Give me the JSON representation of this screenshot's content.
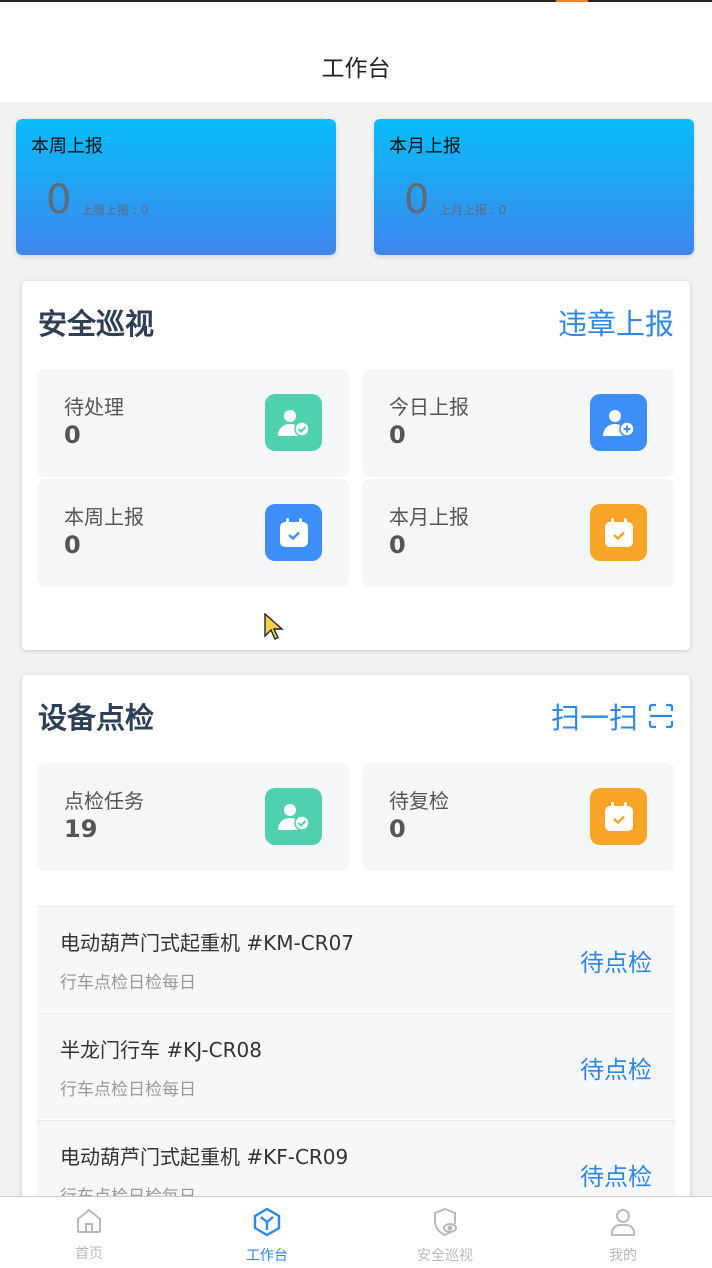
{
  "header": {
    "title": "工作台"
  },
  "summary": [
    {
      "label": "本周上报",
      "count": "0",
      "prev": "上周上报 : 0"
    },
    {
      "label": "本月上报",
      "count": "0",
      "prev": "上月上报 : 0"
    }
  ],
  "safety": {
    "title": "安全巡视",
    "action": "违章上报",
    "stats": [
      {
        "label": "待处理",
        "value": "0",
        "icon": "user-check-icon",
        "color": "#4fd1b0"
      },
      {
        "label": "今日上报",
        "value": "0",
        "icon": "user-add-icon",
        "color": "#3d8ef7"
      },
      {
        "label": "本周上报",
        "value": "0",
        "icon": "calendar-check-icon",
        "color": "#3d8ef7"
      },
      {
        "label": "本月上报",
        "value": "0",
        "icon": "calendar-check-icon",
        "color": "#f7a427"
      }
    ]
  },
  "inspection": {
    "title": "设备点检",
    "action": "扫一扫",
    "action_icon": "scan-icon",
    "stats": [
      {
        "label": "点检任务",
        "value": "19",
        "icon": "user-check-icon",
        "color": "#4fd1b0"
      },
      {
        "label": "待复检",
        "value": "0",
        "icon": "calendar-check-icon",
        "color": "#f7a427"
      }
    ],
    "items": [
      {
        "name": "电动葫芦门式起重机 #KM-CR07",
        "sub": "行车点检日检每日",
        "status": "待点检"
      },
      {
        "name": "半龙门行车 #KJ-CR08",
        "sub": "行车点检日检每日",
        "status": "待点检"
      },
      {
        "name": "电动葫芦门式起重机 #KF-CR09",
        "sub": "行车点检日检每日",
        "status": "待点检"
      }
    ]
  },
  "tabs": [
    {
      "label": "首页",
      "icon": "home-icon",
      "active": false
    },
    {
      "label": "工作台",
      "icon": "workbench-icon",
      "active": true
    },
    {
      "label": "安全巡视",
      "icon": "shield-eye-icon",
      "active": false
    },
    {
      "label": "我的",
      "icon": "user-icon",
      "active": false
    }
  ],
  "colors": {
    "accent": "#2f87e6",
    "teal": "#4fd1b0",
    "blue": "#3d8ef7",
    "orange": "#f7a427"
  }
}
